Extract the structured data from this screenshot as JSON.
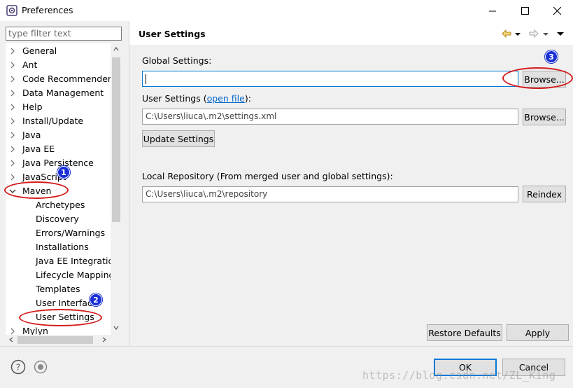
{
  "window": {
    "title": "Preferences"
  },
  "filter": {
    "placeholder": "type filter text"
  },
  "tree": {
    "items": [
      {
        "label": "General",
        "level": 0,
        "expanded": false
      },
      {
        "label": "Ant",
        "level": 0,
        "expanded": false
      },
      {
        "label": "Code Recommenders",
        "level": 0,
        "expanded": false
      },
      {
        "label": "Data Management",
        "level": 0,
        "expanded": false
      },
      {
        "label": "Help",
        "level": 0,
        "expanded": false
      },
      {
        "label": "Install/Update",
        "level": 0,
        "expanded": false
      },
      {
        "label": "Java",
        "level": 0,
        "expanded": false
      },
      {
        "label": "Java EE",
        "level": 0,
        "expanded": false
      },
      {
        "label": "Java Persistence",
        "level": 0,
        "expanded": false
      },
      {
        "label": "JavaScript",
        "level": 0,
        "expanded": false
      },
      {
        "label": "Maven",
        "level": 0,
        "expanded": true
      },
      {
        "label": "Archetypes",
        "level": 1
      },
      {
        "label": "Discovery",
        "level": 1
      },
      {
        "label": "Errors/Warnings",
        "level": 1
      },
      {
        "label": "Installations",
        "level": 1
      },
      {
        "label": "Java EE Integration",
        "level": 1
      },
      {
        "label": "Lifecycle Mappings",
        "level": 1
      },
      {
        "label": "Templates",
        "level": 1
      },
      {
        "label": "User Interface",
        "level": 1
      },
      {
        "label": "User Settings",
        "level": 1,
        "selected": true
      },
      {
        "label": "Mylyn",
        "level": 0,
        "expanded": false
      }
    ]
  },
  "page": {
    "title": "User Settings",
    "global_settings_label": "Global Settings:",
    "global_settings_value": "",
    "browse_label": "Browse...",
    "user_settings_label_pre": "User Settings (",
    "user_settings_link": "open file",
    "user_settings_label_post": "):",
    "user_settings_value": "C:\\Users\\liuca\\.m2\\settings.xml",
    "update_settings_label": "Update Settings",
    "local_repo_label": "Local Repository (From merged user and global settings):",
    "local_repo_value": "C:\\Users\\liuca\\.m2\\repository",
    "reindex_label": "Reindex",
    "restore_defaults_label": "Restore Defaults",
    "apply_label": "Apply"
  },
  "footer": {
    "ok_label": "OK",
    "cancel_label": "Cancel"
  },
  "annotations": {
    "badge_1": "1",
    "badge_2": "2",
    "badge_3": "3",
    "color": "#d41c1c",
    "badge_color": "#1a2fd4"
  },
  "watermark": "https://blog.csdn.net/ZL_King"
}
